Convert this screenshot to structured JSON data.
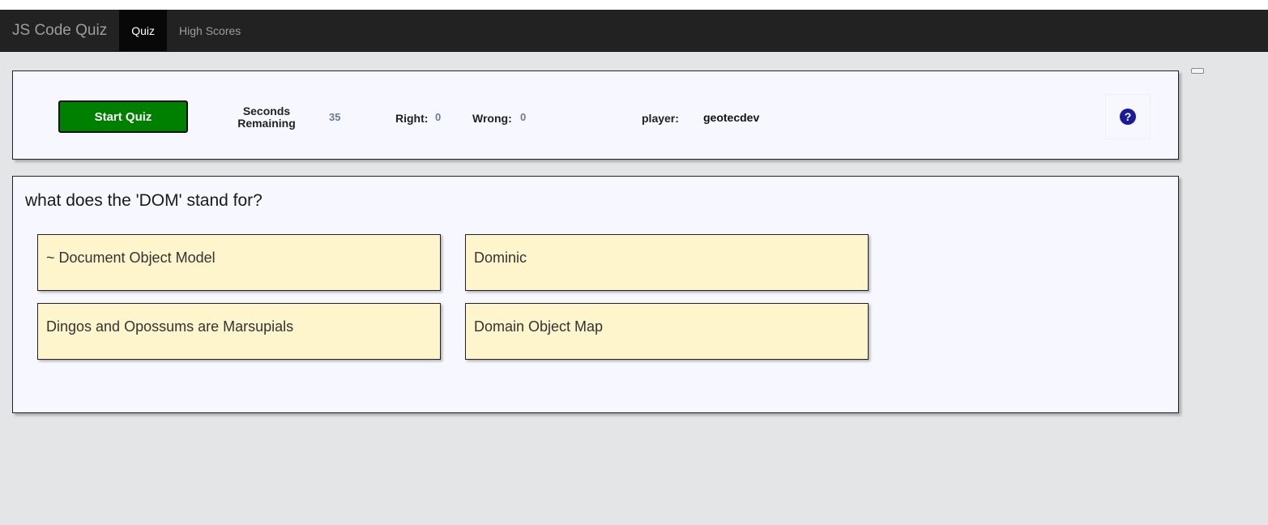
{
  "navbar": {
    "brand": "JS Code Quiz",
    "tabs": [
      {
        "label": "Quiz",
        "active": true
      },
      {
        "label": "High Scores",
        "active": false
      }
    ]
  },
  "status": {
    "start_label": "Start Quiz",
    "seconds_label": "Seconds Remaining",
    "seconds_value": "35",
    "right_label": "Right:",
    "right_value": "0",
    "wrong_label": "Wrong:",
    "wrong_value": "0",
    "player_label": "player:",
    "player_value": "geotecdev",
    "help_icon": "question-circle-icon",
    "help_glyph": "?"
  },
  "question": {
    "text": "what does the 'DOM' stand for?",
    "answers": [
      "~ Document Object Model",
      "Dominic",
      "Dingos and Opossums are Marsupials",
      "Domain Object Map"
    ]
  },
  "colors": {
    "start_button": "#008000",
    "answer_background": "#fff5cc",
    "navbar_background": "#222222",
    "help_icon": "#1a1a9c"
  }
}
